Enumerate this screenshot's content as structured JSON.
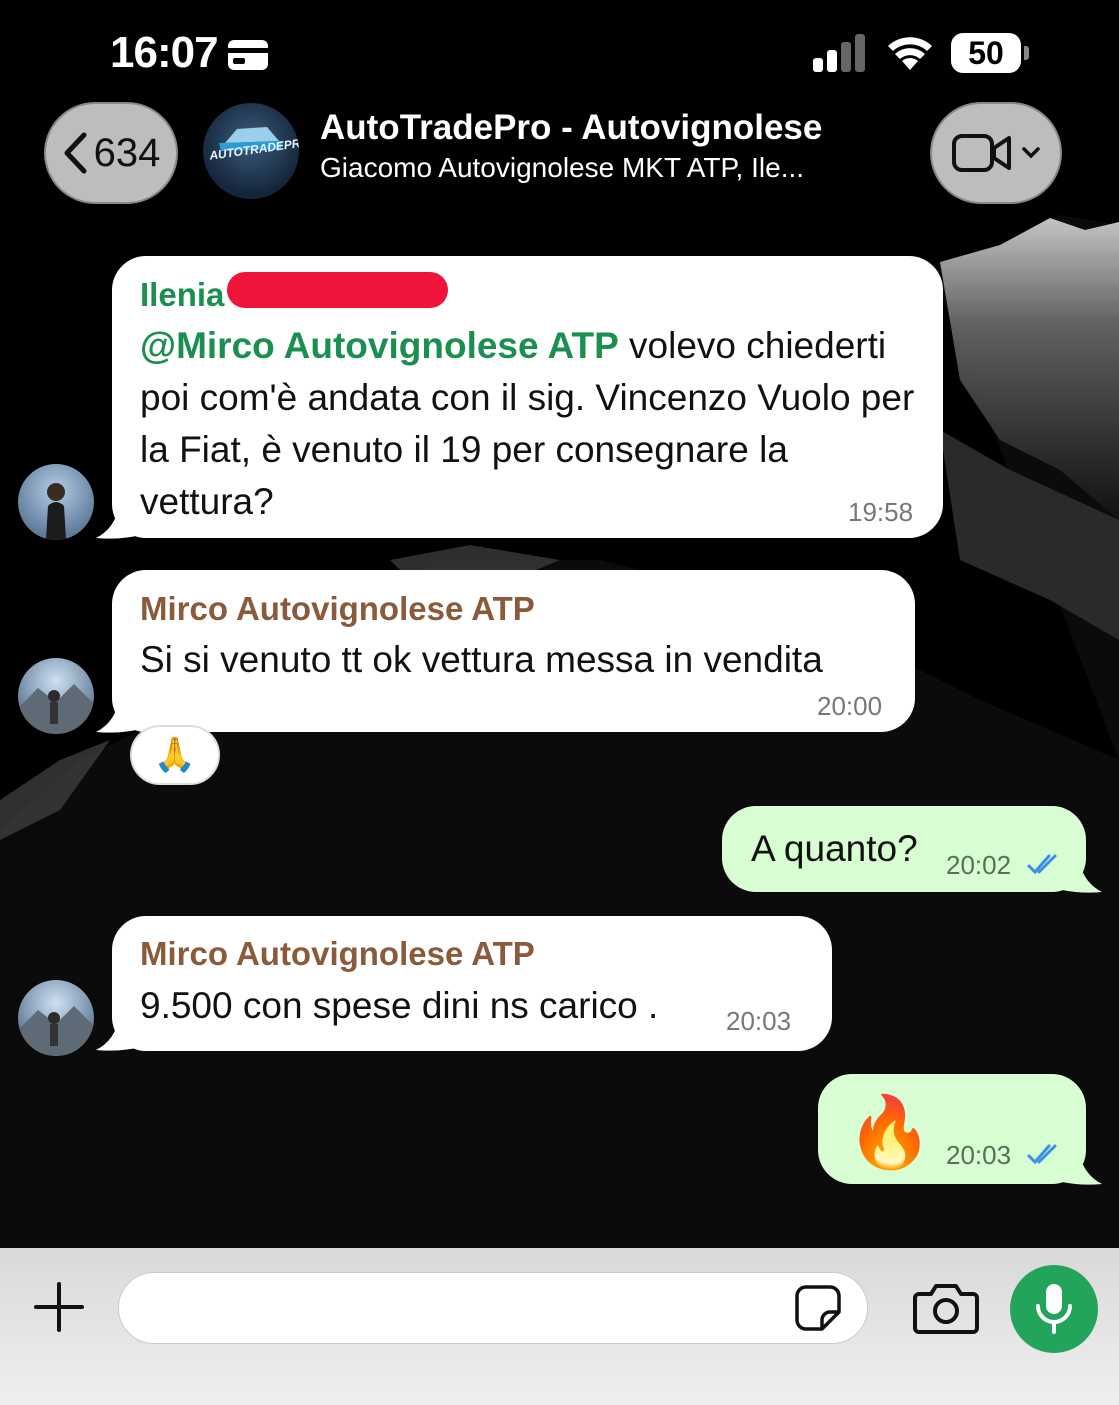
{
  "status_bar": {
    "time": "16:07",
    "battery": "50"
  },
  "header": {
    "back_count": "634",
    "group_name": "AutoTradePro - Autovignolese",
    "participants": "Giacomo Autovignolese MKT ATP, Ile...",
    "avatar_logo_text": "AUTOTRADEPRO"
  },
  "messages": [
    {
      "direction": "incoming",
      "sender": "Ilenia",
      "mention": "@Mirco Autovignolese ATP",
      "text": " volevo chiederti poi com'è andata con il sig. Vincenzo Vuolo per la Fiat, è venuto il 19 per consegnare la vettura?",
      "time": "19:58"
    },
    {
      "direction": "incoming",
      "sender": "Mirco Autovignolese ATP",
      "text": "Si si venuto tt ok vettura messa in vendita",
      "time": "20:00",
      "reaction": "🙏"
    },
    {
      "direction": "outgoing",
      "text": "A quanto?",
      "time": "20:02",
      "status": "read"
    },
    {
      "direction": "incoming",
      "sender": "Mirco Autovignolese ATP",
      "text": "9.500 con spese dini ns carico .",
      "time": "20:03"
    },
    {
      "direction": "outgoing",
      "text": "🔥",
      "time": "20:03",
      "status": "read"
    }
  ],
  "colors": {
    "sender_ilenia": "#1b8f50",
    "sender_mirco": "#8a5a3a",
    "outgoing_bubble": "#d8fdd2",
    "read_ticks": "#3a8fe8",
    "mic_button": "#22a45a"
  },
  "composer": {
    "plus_icon": "plus-icon",
    "sticker_icon": "sticker-icon",
    "camera_icon": "camera-icon",
    "mic_icon": "microphone-icon"
  }
}
